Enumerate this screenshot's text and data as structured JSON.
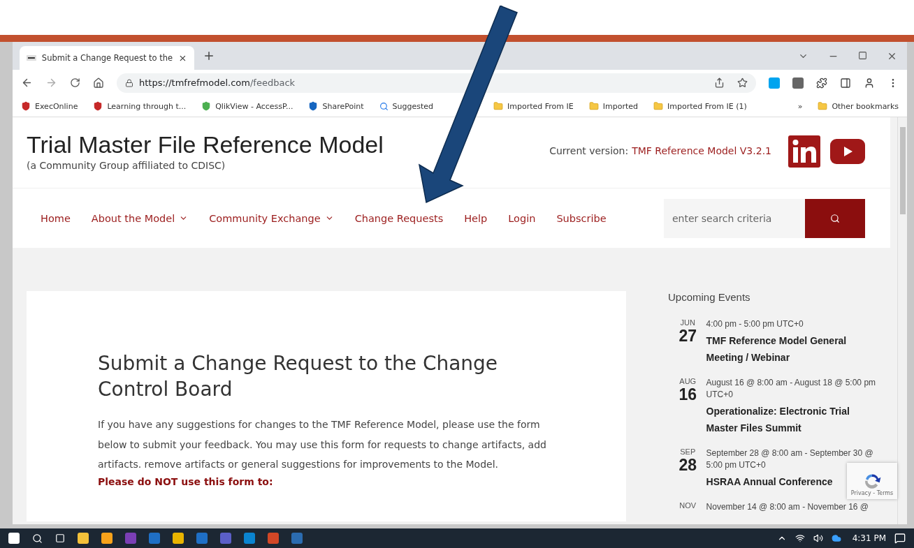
{
  "browser": {
    "tab": {
      "title": "Submit a Change Request to the"
    },
    "url": {
      "host": "https://tmfrefmodel.com",
      "path": "/feedback"
    },
    "bookmarks": [
      {
        "label": "ExecOnline",
        "kind": "site",
        "color": "#c62828"
      },
      {
        "label": "Learning through t...",
        "kind": "site",
        "color": "#c62828"
      },
      {
        "label": "QlikView - AccessP...",
        "kind": "site",
        "color": "#4caf50"
      },
      {
        "label": "SharePoint",
        "kind": "site",
        "color": "#1565c0"
      },
      {
        "label": "Suggested",
        "kind": "search"
      },
      {
        "label": "Imported From IE",
        "kind": "folder"
      },
      {
        "label": "Imported",
        "kind": "folder"
      },
      {
        "label": "Imported From IE (1)",
        "kind": "folder"
      }
    ],
    "overflow": "»",
    "other_bookmarks": "Other bookmarks"
  },
  "site": {
    "title": "Trial Master File Reference Model",
    "subtitle": "(a Community Group affiliated to CDISC)",
    "version_label": "Current version:",
    "version_link": "TMF Reference Model V3.2.1",
    "nav": [
      {
        "label": "Home",
        "has_menu": false
      },
      {
        "label": "About the Model",
        "has_menu": true
      },
      {
        "label": "Community Exchange",
        "has_menu": true
      },
      {
        "label": "Change Requests",
        "has_menu": false
      },
      {
        "label": "Help",
        "has_menu": false
      },
      {
        "label": "Login",
        "has_menu": false
      },
      {
        "label": "Subscribe",
        "has_menu": false
      }
    ],
    "search": {
      "placeholder": "enter search criteria"
    }
  },
  "article": {
    "title": "Submit a Change Request to the Change Control Board",
    "intro": "If you have any suggestions for changes to the TMF Reference Model, please use the form below to submit your feedback. You may use this form for requests to change artifacts, add artifacts. remove artifacts or general suggestions for improvements to the Model.",
    "warning": "Please do NOT use this form to:"
  },
  "sidebar": {
    "heading": "Upcoming Events",
    "events": [
      {
        "month": "JUN",
        "day": "27",
        "time": "4:00 pm - 5:00 pm UTC+0",
        "title": "TMF Reference Model General Meeting / Webinar"
      },
      {
        "month": "AUG",
        "day": "16",
        "time": "August 16 @ 8:00 am - August 18 @ 5:00 pm UTC+0",
        "title": "Operationalize: Electronic Trial Master Files Summit"
      },
      {
        "month": "SEP",
        "day": "28",
        "time": "September 28 @ 8:00 am - September 30 @ 5:00 pm UTC+0",
        "title": "HSRAA Annual Conference"
      },
      {
        "month": "NOV",
        "time": "November 14 @ 8:00 am - November 16 @"
      }
    ]
  },
  "recaptcha": {
    "text": "Privacy - Terms"
  },
  "taskbar": {
    "time": "4:31 PM"
  }
}
